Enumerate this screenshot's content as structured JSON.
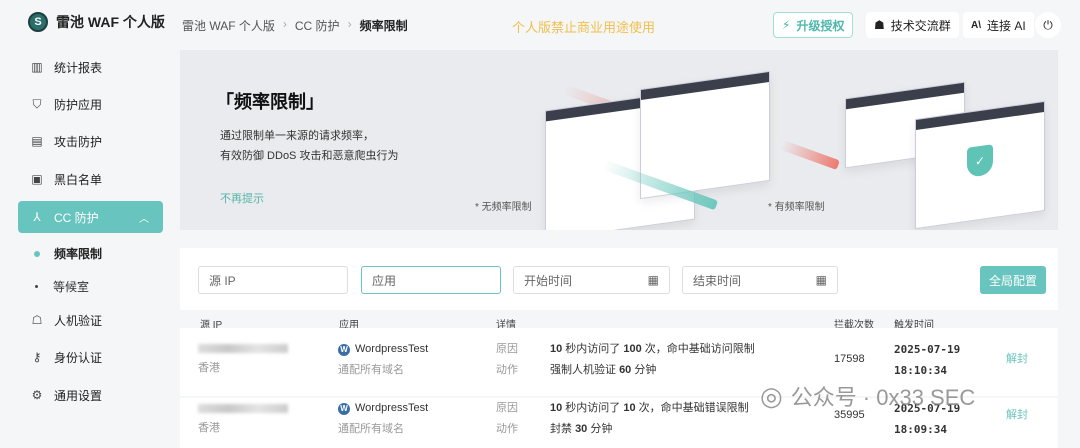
{
  "app": {
    "name": "雷池 WAF 个人版"
  },
  "breadcrumb": [
    "雷池 WAF 个人版",
    "CC 防护",
    "频率限制"
  ],
  "notice": "个人版禁止商业用途使用",
  "topbar": {
    "upgrade": "升级授权",
    "community": "技术交流群",
    "ai": "连接 AI"
  },
  "sidebar": {
    "items": [
      "统计报表",
      "防护应用",
      "攻击防护",
      "黑白名单",
      "CC 防护",
      "人机验证",
      "身份认证",
      "通用设置"
    ],
    "sub": [
      "频率限制",
      "等候室"
    ]
  },
  "banner": {
    "title": "「频率限制」",
    "line1": "通过限制单一来源的请求频率，",
    "line2": "有效防御 DDoS 攻击和恶意爬虫行为",
    "dismiss": "不再提示",
    "cap_without": "* 无频率限制",
    "cap_with": "* 有频率限制"
  },
  "filters": {
    "ip": "源 IP",
    "app": "应用",
    "start": "开始时间",
    "end": "结束时间",
    "global": "全局配置"
  },
  "table": {
    "headers": [
      "源 IP",
      "应用",
      "详情",
      "拦截次数",
      "触发时间"
    ],
    "rows": [
      {
        "location": "香港",
        "app": "WordpressTest",
        "domain": "通配所有域名",
        "reason_label": "原因",
        "action_label": "动作",
        "r1": "10",
        "r2": " 秒内访问了 ",
        "r3": "100",
        "r4": " 次，命中基础访问限制",
        "a1": "强制人机验证 ",
        "a2": "60",
        "a3": " 分钟",
        "count": "17598",
        "date": "2025-07-19",
        "time": "18:10:34",
        "op": "解封"
      },
      {
        "location": "香港",
        "app": "WordpressTest",
        "domain": "通配所有域名",
        "reason_label": "原因",
        "action_label": "动作",
        "r1": "10",
        "r2": " 秒内访问了 ",
        "r3": "10",
        "r4": " 次，命中基础错误限制",
        "a1": "封禁 ",
        "a2": "30",
        "a3": " 分钟",
        "count": "35995",
        "date": "2025-07-19",
        "time": "18:09:34",
        "op": "解封"
      }
    ]
  },
  "watermark": "公众号 · 0x33 SEC"
}
